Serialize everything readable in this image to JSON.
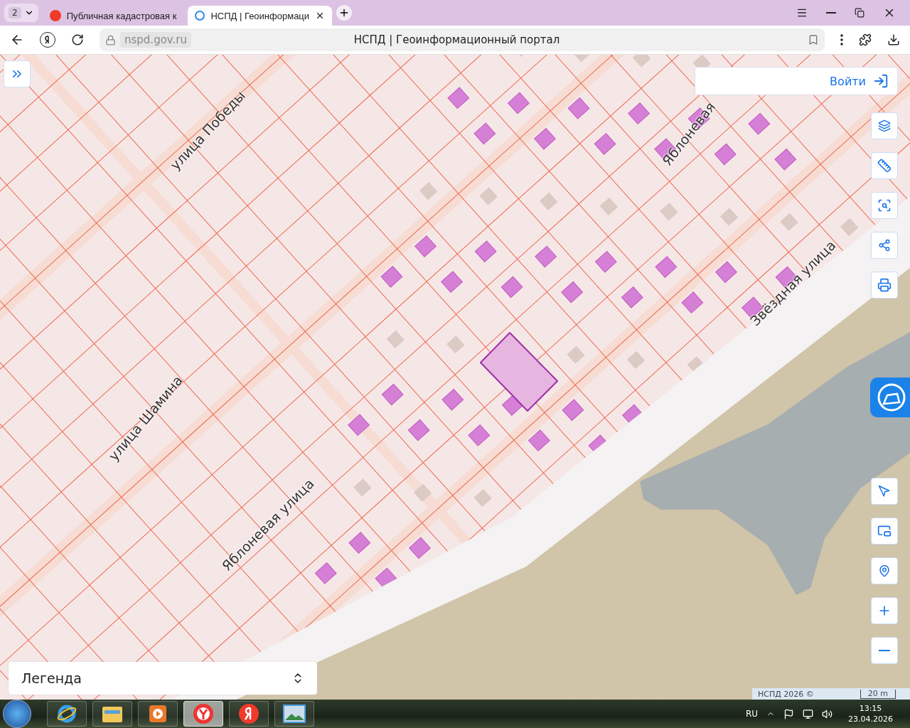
{
  "browser": {
    "tab_count": "2",
    "tabs": [
      {
        "title": "Публичная кадастровая к",
        "selected": false,
        "kind": "yandex"
      },
      {
        "title": "НСПД | Геоинформаци",
        "selected": true,
        "kind": "nspd"
      }
    ],
    "address": "nspd.gov.ru",
    "page_title": "НСПД | Геоинформационный портал"
  },
  "map": {
    "login": "Войти",
    "street_labels": [
      {
        "text": "улица Победы"
      },
      {
        "text": "Яблоневая"
      },
      {
        "text": "Звёздная  улица"
      },
      {
        "text": "улица Шамина"
      },
      {
        "text": "Яблоневая  улица"
      }
    ],
    "legend": "Легенда",
    "attribution": "НСПД 2026 ©",
    "scale": "20 m"
  },
  "taskbar": {
    "apps": [
      {
        "kind": "ie",
        "selected": false
      },
      {
        "kind": "explorer",
        "selected": false
      },
      {
        "kind": "media",
        "selected": false
      },
      {
        "kind": "browser",
        "selected": true
      },
      {
        "kind": "yandex",
        "selected": false
      },
      {
        "kind": "photos",
        "selected": false
      }
    ],
    "language": "RU",
    "time": "13:15",
    "date": "23.04.2026"
  }
}
